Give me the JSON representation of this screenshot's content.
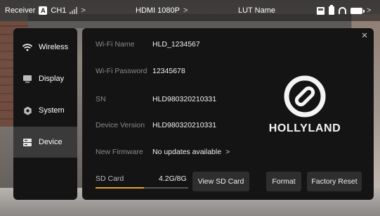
{
  "status_bar": {
    "receiver_label": "Receiver",
    "channel_badge": "A",
    "channel_label": "CH1",
    "signal_icon": "signal-bars-icon",
    "chevron": ">",
    "hdmi_label": "HDMI 1080P",
    "hdmi_chevron": ">",
    "lut_label": "LUT Name",
    "right_chevron": ">"
  },
  "sidebar": {
    "items": [
      {
        "label": "Wireless",
        "icon": "wifi-icon",
        "active": false
      },
      {
        "label": "Display",
        "icon": "monitor-icon",
        "active": false
      },
      {
        "label": "System",
        "icon": "gear-icon",
        "active": false
      },
      {
        "label": "Device",
        "icon": "device-icon",
        "active": true
      }
    ]
  },
  "device": {
    "close": "×",
    "rows": [
      {
        "label": "Wi-Fi Name",
        "value": "HLD_1234567"
      },
      {
        "label": "Wi-Fi Password",
        "value": "12345678"
      },
      {
        "label": "SN",
        "value": "HLD980320210331"
      },
      {
        "label": "Device Version",
        "value": "HLD980320210331"
      },
      {
        "label": "New Firmware",
        "value": "No updates available",
        "chevron": ">"
      }
    ],
    "brand": "HOLLYLAND",
    "sd_card": {
      "label": "SD Card",
      "usage": "4.2G/8G",
      "used_fraction": 0.525
    },
    "buttons": {
      "view_sd": "View SD Card",
      "format": "Format",
      "factory_reset": "Factory Reset"
    }
  },
  "colors": {
    "accent": "#e8a424",
    "panel": "#141414",
    "active_item": "#3a3a3a"
  }
}
